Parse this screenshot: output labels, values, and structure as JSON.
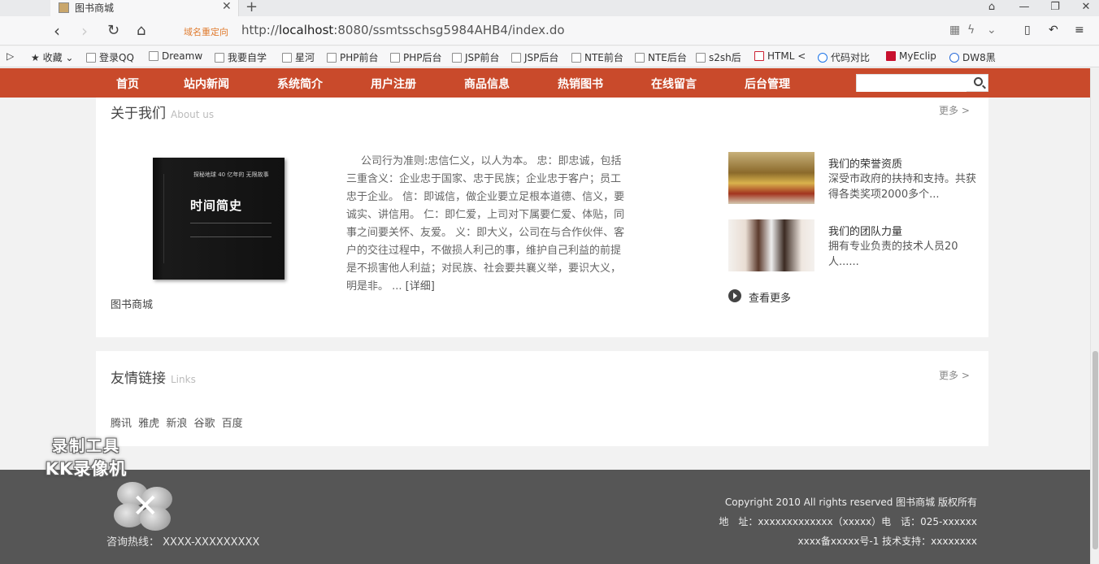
{
  "browser": {
    "tab_title": "图书商城",
    "redirect_label": "域名重定向",
    "url_prefix": "http://",
    "url_host": "localhost",
    "url_rest": ":8080/ssmtsschsg5984AHB4/index.do",
    "bookmarks": [
      "收藏",
      "登录QQ",
      "Dreamw",
      "我要自学",
      "星河",
      "PHP前台",
      "PHP后台",
      "JSP前台",
      "JSP后台",
      "NTE前台",
      "NTE后台",
      "s2sh后",
      "HTML <",
      "代码对比",
      "MyEclip",
      "DW8黑"
    ]
  },
  "nav": {
    "items": [
      "首页",
      "站内新闻",
      "系统简介",
      "用户注册",
      "商品信息",
      "热销图书",
      "在线留言",
      "后台管理"
    ],
    "search_placeholder": ""
  },
  "about": {
    "title": "关于我们",
    "subtitle": "About us",
    "more": "更多 >",
    "book_small": "探秘地球 40 亿年的 无限故事",
    "book_title": "时间简史",
    "book_caption": "图书商城",
    "text": "公司行为准则:忠信仁义，以人为本。 忠：即忠诚，包括三重含义：企业忠于国家、忠于民族；企业忠于客户；员工忠于企业。 信：即诚信，做企业要立足根本道德、信义，要诚实、讲信用。 仁：即仁爱，上司对下属要仁爱、体贴，同事之间要关怀、友爱。 义：即大义，公司在与合作伙伴、客户的交往过程中，不做损人利己的事，维护自己利益的前提是不损害他人利益；对民族、社会要共襄义举，要识大义，明是非。 ...",
    "detail_link": "[详细]",
    "side": [
      {
        "title": "我们的荣誉资质",
        "desc": "深受市政府的扶持和支持。共获得各类奖项2000多个..."
      },
      {
        "title": "我们的团队力量",
        "desc": "拥有专业负责的技术人员20人......"
      }
    ],
    "view_more": "查看更多"
  },
  "links": {
    "title": "友情链接",
    "subtitle": "Links",
    "more": "更多 >",
    "items": [
      "腾讯",
      "雅虎",
      "新浪",
      "谷歌",
      "百度"
    ]
  },
  "footer": {
    "hotline": "咨询热线： XXXX-XXXXXXXXX",
    "copyright": "Copyright 2010 All rights reserved 图书商城 版权所有",
    "address": "地　址：xxxxxxxxxxxxx（xxxxx）电　话：025-xxxxxx",
    "icp": "xxxx备xxxxx号-1 技术支持：xxxxxxxx"
  },
  "watermark": {
    "line1": "录制工具",
    "line2": "KK录像机"
  }
}
